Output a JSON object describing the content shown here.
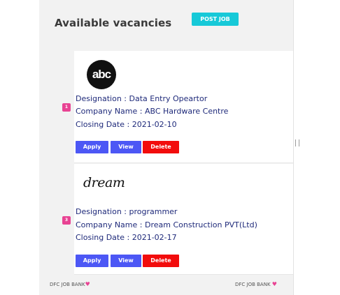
{
  "header": {
    "title": "Available vacancies",
    "post_button": "POST JOB"
  },
  "vacancies": [
    {
      "number": "1",
      "logo_text": "abc",
      "designation": "Designation : Data Entry Opeartor",
      "company": "Company Name : ABC Hardware Centre",
      "closing": "Closing Date : 2021-02-10",
      "apply_label": "Apply",
      "view_label": "View",
      "delete_label": "Delete"
    },
    {
      "number": "3",
      "logo_text": "dream",
      "designation": "Designation : programmer",
      "company": "Company Name : Dream Construction PVT(Ltd)",
      "closing": "Closing Date : 2021-02-17",
      "apply_label": "Apply",
      "view_label": "View",
      "delete_label": "Delete"
    }
  ],
  "footer": {
    "left": "DFC JOB BANK",
    "right": "DFC JOB BANK",
    "heart_icon": "heart-icon"
  },
  "colors": {
    "accent": "#17c9d8",
    "primary": "#4c57f5",
    "danger": "#f20c0c",
    "badge": "#e84393",
    "text": "#1f2a7a"
  }
}
